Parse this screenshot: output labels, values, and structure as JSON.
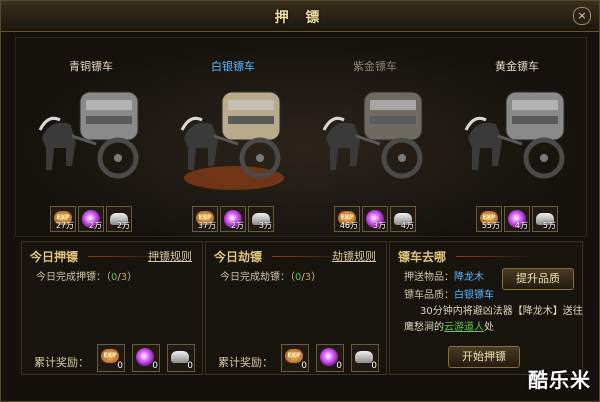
{
  "window": {
    "title": "押 镖",
    "close": "×"
  },
  "carts": [
    {
      "name": "青铜镖车",
      "state": "normal",
      "rewards": [
        "27万",
        "2万",
        "2万"
      ]
    },
    {
      "name": "白银镖车",
      "state": "active",
      "rewards": [
        "37万",
        "2万",
        "3万"
      ]
    },
    {
      "name": "紫金镖车",
      "state": "dim",
      "rewards": [
        "46万",
        "3万",
        "4万"
      ]
    },
    {
      "name": "黄金镖车",
      "state": "normal",
      "rewards": [
        "55万",
        "4万",
        "5万"
      ]
    }
  ],
  "reward_icons": [
    "exp-icon",
    "purple-orb-icon",
    "silver-ingot-icon"
  ],
  "exp_text": "EXP",
  "escort_panel": {
    "title": "今日押镖",
    "rules_link": "押镖规则",
    "done_label": "今日完成押镖：",
    "open": "（",
    "done": "0",
    "sep": "/",
    "total": "3",
    "close": "）",
    "accum_label": "累计奖励：",
    "accum": [
      "0",
      "0",
      "0"
    ]
  },
  "rob_panel": {
    "title": "今日劫镖",
    "rules_link": "劫镖规则",
    "done_label": "今日完成劫镖：",
    "open": "（",
    "done": "0",
    "sep": "/",
    "total": "3",
    "close": "）",
    "accum_label": "累计奖励：",
    "accum": [
      "0",
      "0",
      "0"
    ]
  },
  "dest_panel": {
    "title": "镖车去哪",
    "item_label": "押送物品：",
    "item_value": "降龙木",
    "quality_label": "镖车品质：",
    "quality_value": "白银镖车",
    "upgrade_button": "提升品质",
    "desc_pre": "30分钟内将避凶法器【降龙木】送往鹰愁涧的",
    "desc_link": "云游道人",
    "desc_post": "处",
    "start_button": "开始押镖"
  },
  "watermark": "酷乐米"
}
